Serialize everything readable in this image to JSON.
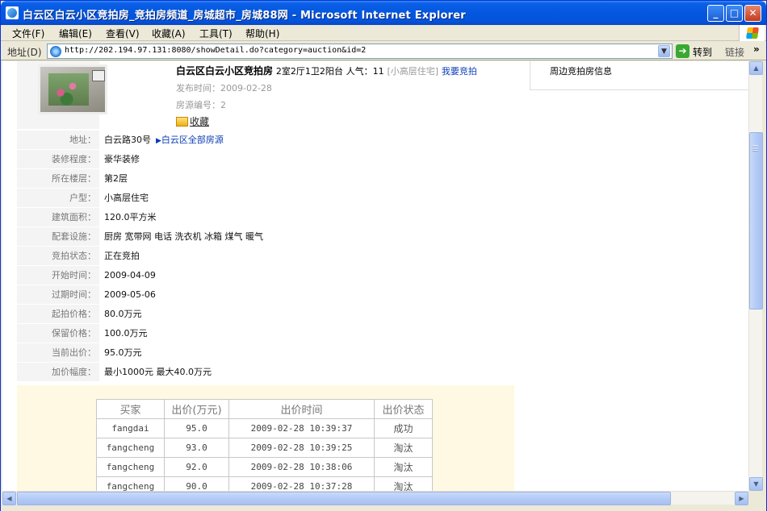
{
  "window": {
    "title": "白云区白云小区竞拍房_竞拍房频道_房城超市_房城88网 - Microsoft Internet Explorer",
    "min_glyph": "_",
    "max_glyph": "□",
    "close_glyph": "✕"
  },
  "menu": [
    "文件(F)",
    "编辑(E)",
    "查看(V)",
    "收藏(A)",
    "工具(T)",
    "帮助(H)"
  ],
  "address": {
    "label": "地址(D)",
    "url": "http://202.194.97.131:8080/showDetail.do?category=auction&id=2",
    "go_label": "转到",
    "links_label": "链接",
    "links_more": "»"
  },
  "listing": {
    "title": "白云区白云小区竞拍房",
    "rooms": "2室2厅1卫2阳台",
    "popularity": "人气：11",
    "type": "[小高层住宅]",
    "bid_link": "我要竞拍",
    "publish_time": "发布时间：2009-02-28",
    "source_no": "房源编号：2",
    "favorite": "收藏"
  },
  "side": {
    "title": "周边竞拍房信息"
  },
  "details": [
    {
      "label": "地址：",
      "value": "白云路30号",
      "link": "白云区全部房源"
    },
    {
      "label": "装修程度：",
      "value": "豪华装修"
    },
    {
      "label": "所在楼层：",
      "value": "第2层"
    },
    {
      "label": "户型：",
      "value": "小高层住宅"
    },
    {
      "label": "建筑面积：",
      "value": "120.0平方米"
    },
    {
      "label": "配套设施：",
      "value": "厨房 宽带网 电话 洗衣机 冰箱 煤气 暖气"
    },
    {
      "label": "竞拍状态：",
      "value": "正在竞拍"
    },
    {
      "label": "开始时间：",
      "value": "2009-04-09"
    },
    {
      "label": "过期时间：",
      "value": "2009-05-06"
    },
    {
      "label": "起拍价格：",
      "value": "80.0万元"
    },
    {
      "label": "保留价格：",
      "value": "100.0万元"
    },
    {
      "label": "当前出价：",
      "value": "95.0万元"
    },
    {
      "label": "加价幅度：",
      "value": "最小1000元 最大40.0万元"
    }
  ],
  "bids": {
    "headers": [
      "买家",
      "出价(万元)",
      "出价时间",
      "出价状态"
    ],
    "rows": [
      [
        "fangdai",
        "95.0",
        "2009-02-28 10:39:37",
        "成功"
      ],
      [
        "fangcheng",
        "93.0",
        "2009-02-28 10:39:25",
        "淘汰"
      ],
      [
        "fangcheng",
        "92.0",
        "2009-02-28 10:38:06",
        "淘汰"
      ],
      [
        "fangcheng",
        "90.0",
        "2009-02-28 10:37:28",
        "淘汰"
      ]
    ]
  },
  "icons": {
    "title": "ie-icon",
    "favorite": "folder-star-icon",
    "go": "green-arrow-icon",
    "windows_logo": "windows-flag-icon"
  }
}
